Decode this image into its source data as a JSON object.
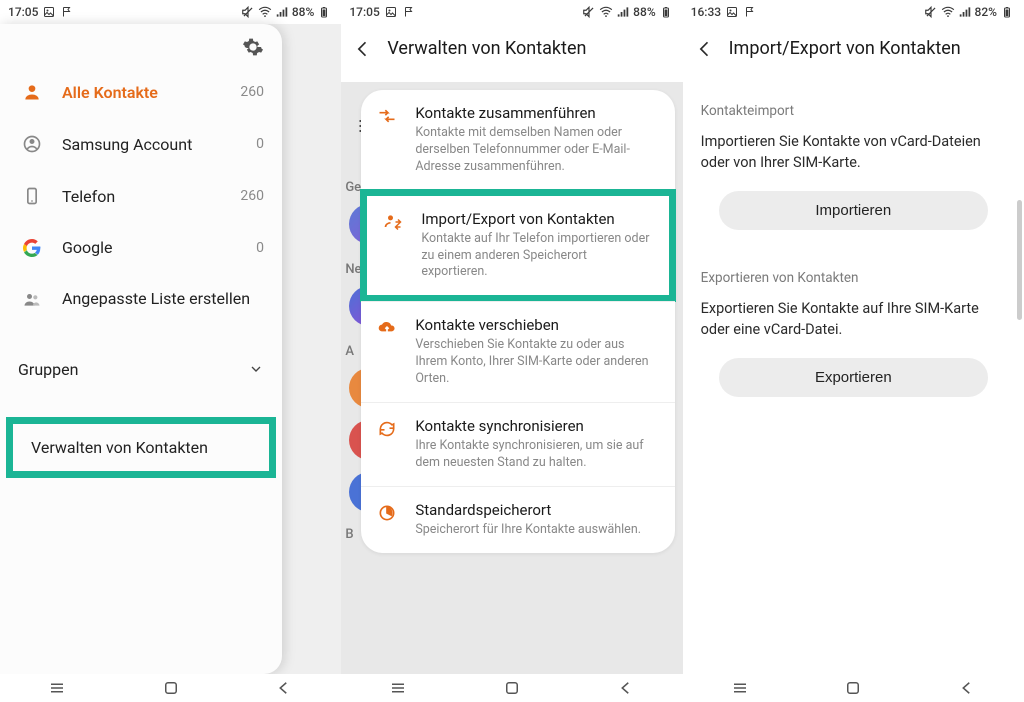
{
  "screen1": {
    "status": {
      "time": "17:05",
      "battery": "88%"
    },
    "accounts": [
      {
        "label": "Alle Kontakte",
        "count": "260",
        "icon": "person"
      },
      {
        "label": "Samsung Account",
        "count": "0",
        "icon": "samsung"
      },
      {
        "label": "Telefon",
        "count": "260",
        "icon": "phone"
      },
      {
        "label": "Google",
        "count": "0",
        "icon": "google"
      },
      {
        "label": "Angepasste Liste erstellen",
        "count": "",
        "icon": "group"
      }
    ],
    "groups_label": "Gruppen",
    "manage_label": "Verwalten von Kontakten"
  },
  "screen2": {
    "status": {
      "time": "17:05",
      "battery": "88%"
    },
    "title": "Verwalten von Kontakten",
    "bg_labels": {
      "gelb": "Gelb",
      "neuig": "Neuig",
      "a": "A",
      "b": "B"
    },
    "rows": [
      {
        "title": "Kontakte zusammenführen",
        "sub": "Kontakte mit demselben Namen oder derselben Telefonnummer oder E-Mail-Adresse zusammenführen."
      },
      {
        "title": "Import/Export von Kontakten",
        "sub": "Kontakte auf Ihr Telefon importieren oder zu einem anderen Speicherort exportieren."
      },
      {
        "title": "Kontakte verschieben",
        "sub": "Verschieben Sie Kontakte zu oder aus Ihrem Konto, Ihrer SIM-Karte oder anderen Orten."
      },
      {
        "title": "Kontakte synchronisieren",
        "sub": "Ihre Kontakte synchronisieren, um sie auf dem neuesten Stand zu halten."
      },
      {
        "title": "Standardspeicherort",
        "sub": "Speicherort für Ihre Kontakte auswählen."
      }
    ]
  },
  "screen3": {
    "status": {
      "time": "16:33",
      "battery": "82%"
    },
    "title": "Import/Export von Kontakten",
    "import": {
      "heading": "Kontakteimport",
      "desc": "Importieren Sie Kontakte von vCard-Dateien oder von Ihrer SIM-Karte.",
      "button": "Importieren"
    },
    "export": {
      "heading": "Exportieren von Kontakten",
      "desc": "Exportieren Sie Kontakte auf Ihre SIM-Karte oder eine vCard-Datei.",
      "button": "Exportieren"
    }
  }
}
